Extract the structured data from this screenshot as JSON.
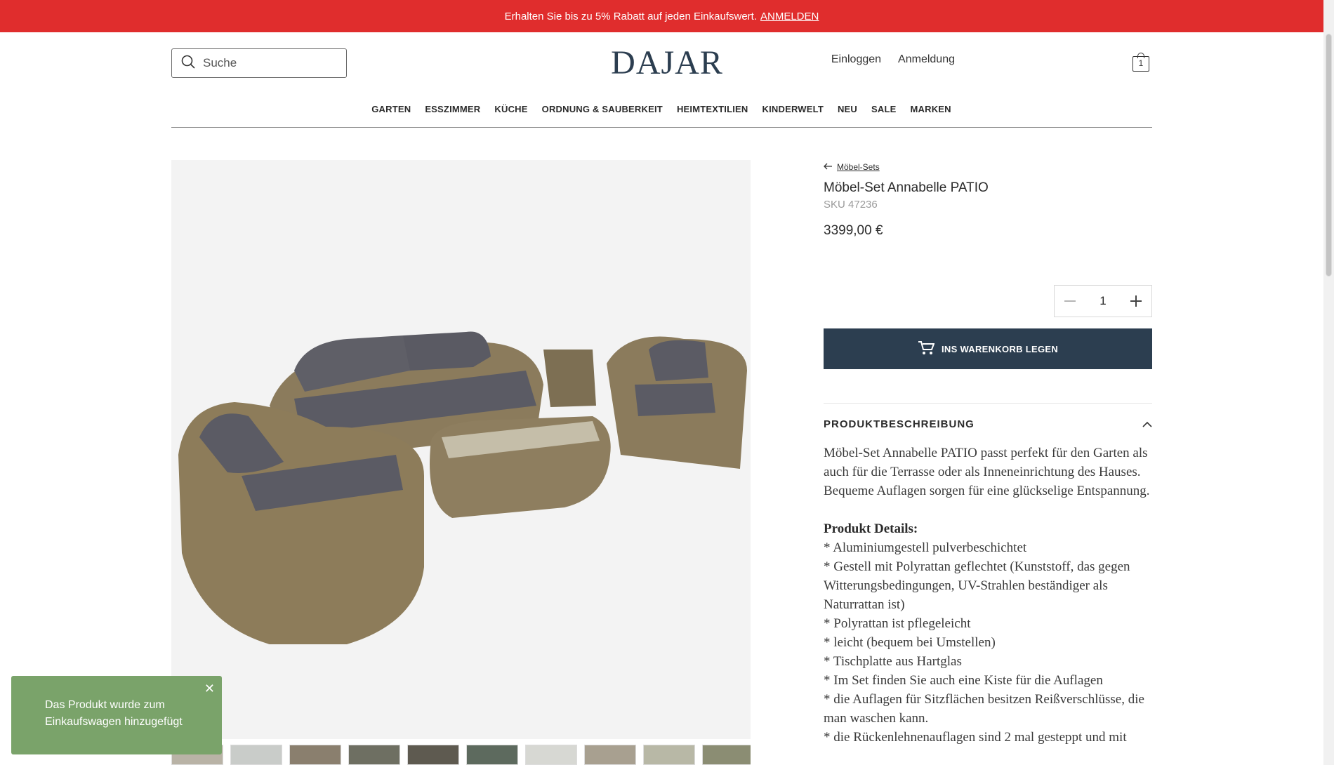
{
  "promo": {
    "text": "Erhalten Sie bis zu 5% Rabatt auf jeden Einkaufswert.",
    "link": "ANMELDEN"
  },
  "search": {
    "placeholder": "Suche"
  },
  "logo": "DAJAR",
  "account": {
    "login": "Einloggen",
    "register": "Anmeldung",
    "cart_count": "1"
  },
  "nav": [
    "GARTEN",
    "ESSZIMMER",
    "KÜCHE",
    "ORDNUNG & SAUBERKEIT",
    "HEIMTEXTILIEN",
    "KINDERWELT",
    "NEU",
    "SALE",
    "MARKEN"
  ],
  "product": {
    "breadcrumb": "Möbel-Sets",
    "title": "Möbel-Set Annabelle PATIO",
    "sku": "SKU 47236",
    "price": "3399,00 €",
    "quantity": "1",
    "add_to_cart": "INS WARENKORB LEGEN"
  },
  "description": {
    "heading": "PRODUKTBESCHREIBUNG",
    "intro": "Möbel-Set Annabelle PATIO passt perfekt für den Garten als auch für die Terrasse oder als Inneneinrichtung des Hauses. Bequeme Auflagen sorgen für eine glückselige Entspannung.",
    "details_heading": "Produkt Details:",
    "details": [
      "* Aluminiumgestell pulverbeschichtet",
      "* Gestell mit Polyrattan geflechtet (Kunststoff, das gegen Witterungsbedingungen, UV-Strahlen beständiger als Naturrattan ist)",
      "* Polyrattan ist pflegeleicht",
      "* leicht (bequem bei Umstellen)",
      "* Tischplatte aus Hartglas",
      "* Im Set finden Sie auch eine Kiste für die Auflagen",
      "* die Auflagen für Sitzflächen besitzen Reißverschlüsse, die man waschen kann.",
      "* die Rückenlehnenauflagen sind 2 mal gesteppt und mit"
    ]
  },
  "toast": {
    "message": "Das Produkt wurde zum Einkaufswagen hinzugefügt"
  },
  "colors": {
    "promo": "#e02d2d",
    "button": "#2c3e50",
    "toast": "#7aa36a"
  }
}
